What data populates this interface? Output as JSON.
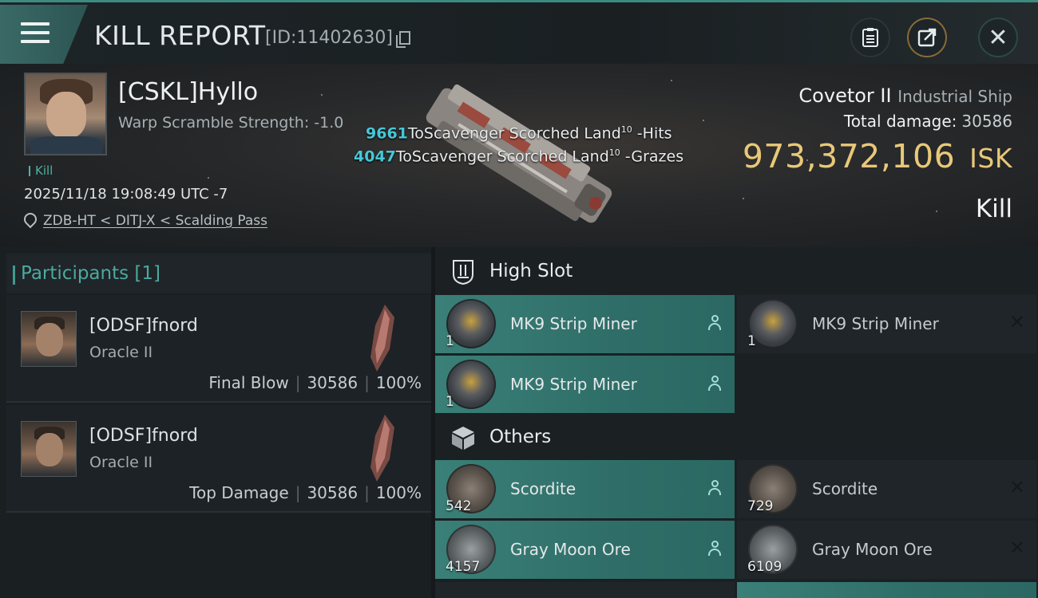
{
  "header": {
    "title": "KILL REPORT",
    "report_id": "[ID:11402630]"
  },
  "victim": {
    "name": "[CSKL]Hyllo",
    "warp_scramble": "Warp Scramble Strength: -1.0",
    "tag": "Kill",
    "datetime": "2025/11/18 19:08:49 UTC -7",
    "location": "ZDB-HT < DITJ-X < Scalding Pass"
  },
  "damage_lines": [
    {
      "amount": "9661",
      "text": "ToScavenger Scorched Land",
      "level": "10",
      "suffix": " -Hits"
    },
    {
      "amount": "4047",
      "text": "ToScavenger Scorched Land",
      "level": "10",
      "suffix": " -Grazes"
    }
  ],
  "ship": {
    "name": "Covetor II",
    "class": "Industrial Ship",
    "total_damage_label": "Total damage:",
    "total_damage": "30586",
    "isk_value": "973,372,106",
    "isk_unit": "ISK",
    "result": "Kill"
  },
  "participants": {
    "title": "Participants [1]",
    "rows": [
      {
        "name": "[ODSF]fnord",
        "ship": "Oracle II",
        "role": "Final Blow",
        "damage": "30586",
        "percent": "100%"
      },
      {
        "name": "[ODSF]fnord",
        "ship": "Oracle II",
        "role": "Top Damage",
        "damage": "30586",
        "percent": "100%"
      }
    ]
  },
  "sections": {
    "high_slot": {
      "title": "High Slot",
      "items": [
        {
          "name": "MK9 Strip Miner",
          "qty": "1",
          "state": "dropped",
          "icon": "strip-miner-icon"
        },
        {
          "name": "MK9 Strip Miner",
          "qty": "1",
          "state": "destroyed",
          "icon": "strip-miner-icon"
        },
        {
          "name": "MK9 Strip Miner",
          "qty": "1",
          "state": "dropped",
          "icon": "strip-miner-icon"
        }
      ]
    },
    "others": {
      "title": "Others",
      "items": [
        {
          "name": "Scordite",
          "qty": "542",
          "state": "dropped",
          "icon": "scordite-ore-icon"
        },
        {
          "name": "Scordite",
          "qty": "729",
          "state": "destroyed",
          "icon": "scordite-ore-icon"
        },
        {
          "name": "Gray Moon Ore",
          "qty": "4157",
          "state": "dropped",
          "icon": "moon-ore-icon"
        },
        {
          "name": "Gray Moon Ore",
          "qty": "6109",
          "state": "destroyed",
          "icon": "moon-ore-icon"
        }
      ]
    }
  },
  "colors": {
    "accent_teal": "#3a8078",
    "isk_gold": "#e8c878",
    "damage_cyan": "#46c8d8"
  }
}
